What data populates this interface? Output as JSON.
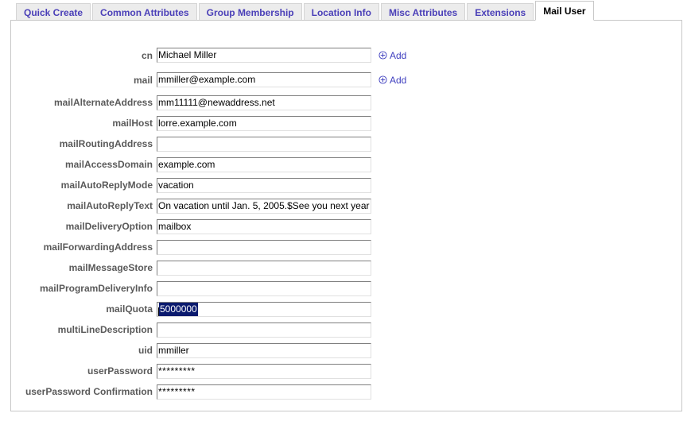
{
  "tabs": [
    {
      "label": "Quick Create",
      "active": false
    },
    {
      "label": "Common Attributes",
      "active": false
    },
    {
      "label": "Group Membership",
      "active": false
    },
    {
      "label": "Location Info",
      "active": false
    },
    {
      "label": "Misc Attributes",
      "active": false
    },
    {
      "label": "Extensions",
      "active": false
    },
    {
      "label": "Mail User",
      "active": true
    }
  ],
  "colors": {
    "tab_text": "#4a3fb8",
    "tab_bg": "#ececec",
    "active_tab_text": "#000000",
    "active_tab_bg": "#ffffff",
    "label_text": "#5a5a5a",
    "link_text": "#3f3fbf",
    "selection_bg": "#0a1a6e",
    "selection_text": "#ffffff",
    "panel_border": "#c8c8c8"
  },
  "add_link": {
    "label": "Add",
    "icon": "circle-plus-icon"
  },
  "fields": [
    {
      "label": "cn",
      "value": "Michael Miller",
      "placeholder": "",
      "has_add": true,
      "selected": false,
      "password": false
    },
    {
      "label": "mail",
      "value": "mmiller@example.com",
      "placeholder": "",
      "has_add": true,
      "selected": false,
      "password": false
    },
    {
      "label": "mailAlternateAddress",
      "value": "mm11111@newaddress.net",
      "placeholder": "",
      "has_add": false,
      "selected": false,
      "password": false
    },
    {
      "label": "mailHost",
      "value": "lorre.example.com",
      "placeholder": "",
      "has_add": false,
      "selected": false,
      "password": false
    },
    {
      "label": "mailRoutingAddress",
      "value": "",
      "placeholder": "",
      "has_add": false,
      "selected": false,
      "password": false
    },
    {
      "label": "mailAccessDomain",
      "value": "example.com",
      "placeholder": "",
      "has_add": false,
      "selected": false,
      "password": false
    },
    {
      "label": "mailAutoReplyMode",
      "value": "vacation",
      "placeholder": "",
      "has_add": false,
      "selected": false,
      "password": false
    },
    {
      "label": "mailAutoReplyText",
      "value": "On vacation until Jan. 5, 2005.$See you next year",
      "placeholder": "",
      "has_add": false,
      "selected": false,
      "password": false
    },
    {
      "label": "mailDeliveryOption",
      "value": "mailbox",
      "placeholder": "",
      "has_add": false,
      "selected": false,
      "password": false
    },
    {
      "label": "mailForwardingAddress",
      "value": "",
      "placeholder": "",
      "has_add": false,
      "selected": false,
      "password": false
    },
    {
      "label": "mailMessageStore",
      "value": "",
      "placeholder": "",
      "has_add": false,
      "selected": false,
      "password": false
    },
    {
      "label": "mailProgramDeliveryInfo",
      "value": "",
      "placeholder": "",
      "has_add": false,
      "selected": false,
      "password": false
    },
    {
      "label": "mailQuota",
      "value": "5000000",
      "placeholder": "",
      "has_add": false,
      "selected": true,
      "password": false
    },
    {
      "label": "multiLineDescription",
      "value": "",
      "placeholder": "",
      "has_add": false,
      "selected": false,
      "password": false
    },
    {
      "label": "uid",
      "value": "mmiller",
      "placeholder": "",
      "has_add": false,
      "selected": false,
      "password": false
    },
    {
      "label": "userPassword",
      "value": "*********",
      "placeholder": "",
      "has_add": false,
      "selected": false,
      "password": true
    },
    {
      "label": "userPassword Confirmation",
      "value": "*********",
      "placeholder": "",
      "has_add": false,
      "selected": false,
      "password": true
    }
  ]
}
